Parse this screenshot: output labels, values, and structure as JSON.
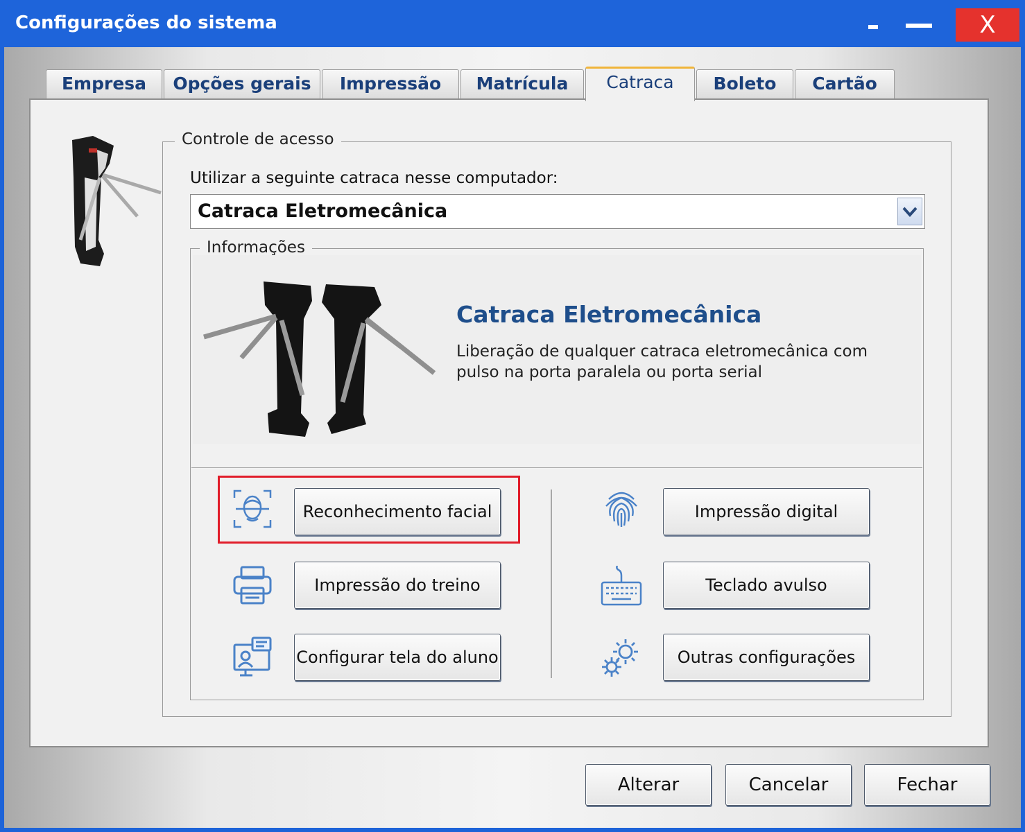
{
  "window": {
    "title": "Configurações do sistema",
    "close_label": "X"
  },
  "tabs": [
    {
      "label": "Empresa"
    },
    {
      "label": "Opções gerais"
    },
    {
      "label": "Impressão"
    },
    {
      "label": "Matrícula"
    },
    {
      "label": "Catraca"
    },
    {
      "label": "Boleto"
    },
    {
      "label": "Cartão"
    }
  ],
  "active_tab": "Catraca",
  "access_control": {
    "legend": "Controle de acesso",
    "select_label": "Utilizar a seguinte catraca nesse computador:",
    "selected_turnstile": "Catraca Eletromecânica"
  },
  "info": {
    "legend": "Informações",
    "title": "Catraca Eletromecânica",
    "description": "Liberação de qualquer catraca eletromecânica com pulso na porta paralela ou porta serial"
  },
  "feature_buttons": {
    "facial": "Reconhecimento facial",
    "print_workout": "Impressão do treino",
    "student_screen": "Configurar tela do aluno",
    "fingerprint": "Impressão digital",
    "keypad": "Teclado avulso",
    "other_settings": "Outras configurações"
  },
  "footer": {
    "alter": "Alterar",
    "cancel": "Cancelar",
    "close": "Fechar"
  },
  "colors": {
    "titlebar": "#1e64da",
    "close_button": "#e5322d",
    "highlight": "#e11d2a",
    "info_title": "#1e4e8b",
    "icon": "#4a82c8"
  }
}
